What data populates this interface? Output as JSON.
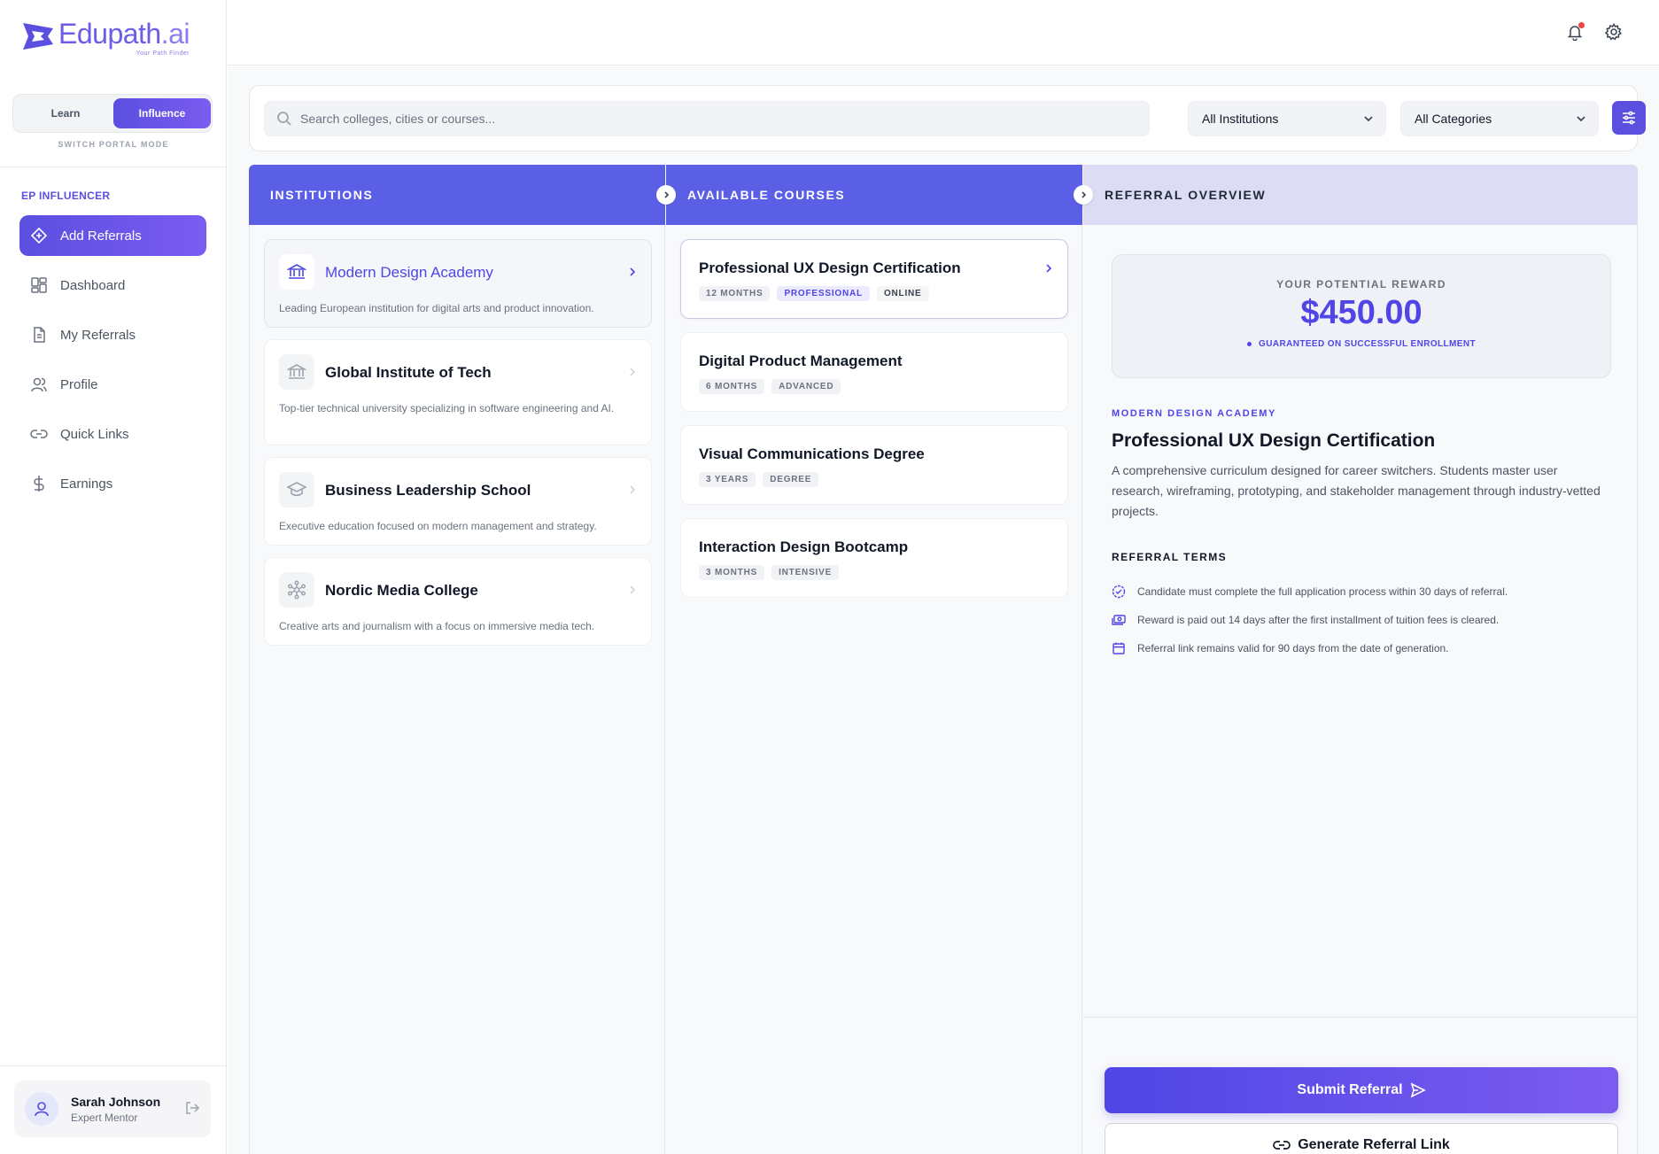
{
  "brand": {
    "name_main": "Edupath",
    "name_suffix": ".ai",
    "tagline": "Your Path Finder",
    "color": "#5b4fe0"
  },
  "mode": {
    "learn": "Learn",
    "influence": "Influence",
    "caption": "SWITCH PORTAL MODE",
    "active": "Influence"
  },
  "sidebar": {
    "section": "EP INFLUENCER",
    "items": [
      {
        "label": "Add Referrals",
        "icon": "add-diamond-icon",
        "active": true
      },
      {
        "label": "Dashboard",
        "icon": "dashboard-grid-icon"
      },
      {
        "label": "My Referrals",
        "icon": "document-icon"
      },
      {
        "label": "Profile",
        "icon": "users-icon"
      },
      {
        "label": "Quick Links",
        "icon": "link-icon"
      },
      {
        "label": "Earnings",
        "icon": "dollar-icon"
      }
    ]
  },
  "user": {
    "name": "Sarah Johnson",
    "role": "Expert Mentor"
  },
  "search": {
    "placeholder": "Search colleges, cities or courses...",
    "institutions_filter": "All Institutions",
    "categories_filter": "All Categories"
  },
  "columns": {
    "institutions": "INSTITUTIONS",
    "courses": "AVAILABLE COURSES",
    "overview": "REFERRAL OVERVIEW"
  },
  "institutions": [
    {
      "name": "Modern Design Academy",
      "desc": "Leading European institution for digital arts and product innovation.",
      "icon": "bank-icon",
      "selected": true
    },
    {
      "name": "Global Institute of Tech",
      "desc": "Top-tier technical university specializing in software engineering and AI.",
      "icon": "bank-icon"
    },
    {
      "name": "Business Leadership School",
      "desc": "Executive education focused on modern management and strategy.",
      "icon": "graduation-cap-icon"
    },
    {
      "name": "Nordic Media College",
      "desc": "Creative arts and journalism with a focus on immersive media tech.",
      "icon": "network-icon"
    }
  ],
  "courses": [
    {
      "title": "Professional UX Design Certification",
      "tags": [
        "12 MONTHS",
        "PROFESSIONAL",
        "ONLINE"
      ],
      "selected": true
    },
    {
      "title": "Digital Product Management",
      "tags": [
        "6 MONTHS",
        "ADVANCED"
      ]
    },
    {
      "title": "Visual Communications Degree",
      "tags": [
        "3 YEARS",
        "DEGREE"
      ]
    },
    {
      "title": "Interaction Design Bootcamp",
      "tags": [
        "3 MONTHS",
        "INTENSIVE"
      ]
    }
  ],
  "overview": {
    "reward_label": "YOUR POTENTIAL REWARD",
    "reward_amount": "$450.00",
    "reward_note": "GUARANTEED ON SUCCESSFUL ENROLLMENT",
    "institution": "MODERN DESIGN ACADEMY",
    "course_title": "Professional UX Design Certification",
    "description": "A comprehensive curriculum designed for career switchers. Students master user research, wireframing, prototyping, and stakeholder management through industry-vetted projects.",
    "terms_heading": "REFERRAL TERMS",
    "terms": [
      "Candidate must complete the full application process within 30 days of referral.",
      "Reward is paid out 14 days after the first installment of tuition fees is cleared.",
      "Referral link remains valid for 90 days from the date of generation."
    ],
    "submit_label": "Submit Referral",
    "link_label": "Generate Referral Link"
  }
}
